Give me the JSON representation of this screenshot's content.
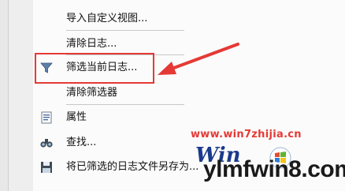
{
  "menu": {
    "items": [
      {
        "label": "导入自定义视图...",
        "icon": ""
      },
      {
        "label": "清除日志...",
        "icon": ""
      },
      {
        "label": "筛选当前日志...",
        "icon": "filter-icon"
      },
      {
        "label": "清除筛选器",
        "icon": ""
      },
      {
        "label": "属性",
        "icon": "properties-icon"
      },
      {
        "label": "查找...",
        "icon": "binoculars-icon"
      },
      {
        "label": "将已筛选的日志文件另存为...",
        "icon": "save-icon"
      }
    ]
  },
  "annotation": {
    "highlight_color": "#e53935"
  },
  "watermark": {
    "url": "www.win7zhijia.cn",
    "brand_prefix": "Win",
    "site": "ylmfwin8.com"
  }
}
